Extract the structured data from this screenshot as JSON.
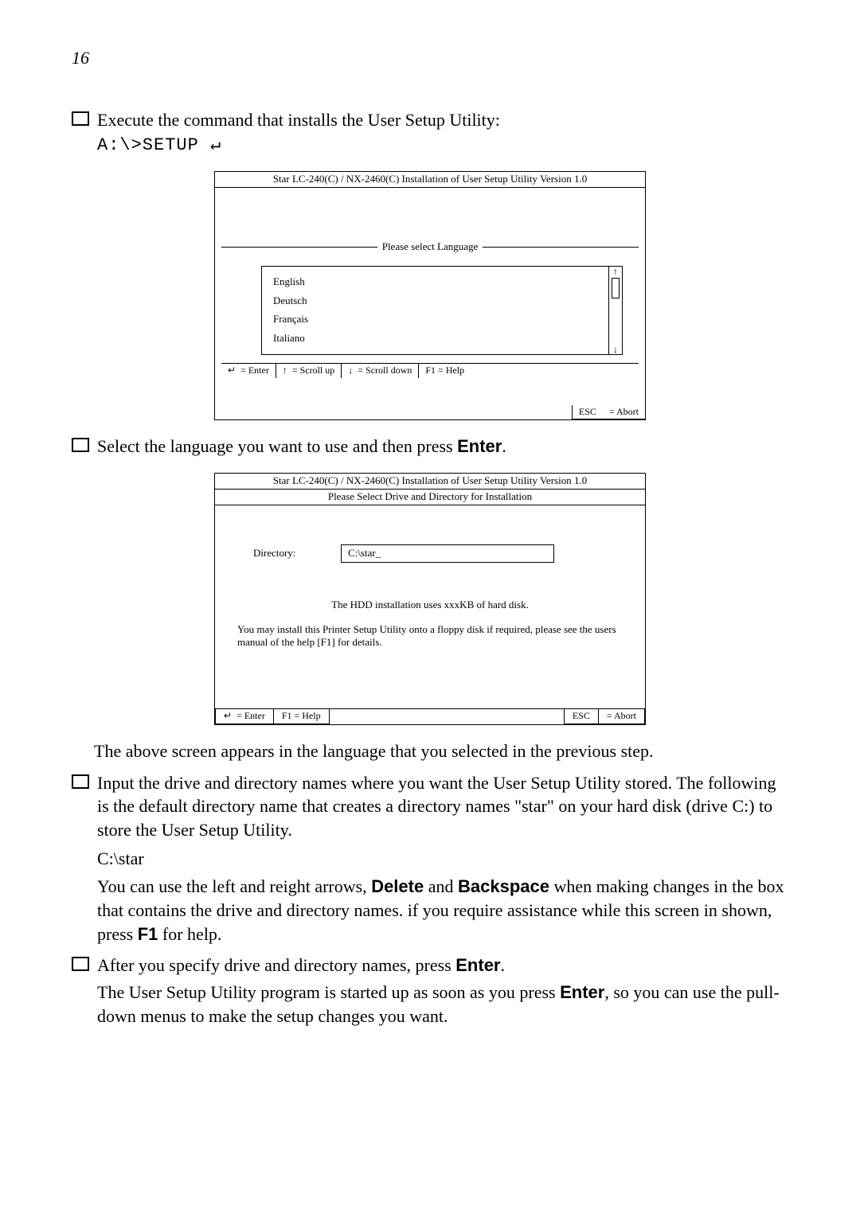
{
  "page_number": "16",
  "bullets": {
    "b1": "Execute the command that installs the User Setup Utility:",
    "b1_cmd": "A:\\>SETUP ↵",
    "b2_pre": "Select the language you want to use and then press ",
    "b2_key": "Enter",
    "b2_post": ".",
    "para_after_dlg2": "The above screen appears in the language that you selected in the previous step.",
    "b3": "Input the drive and directory names where you want the User Setup Utility stored. The following is the default directory name that creates a directory names \"star\" on your hard disk (drive C:) to store the User Setup Utility.",
    "b3_path": "C:\\star",
    "b3_para2_a": "You can use the left and reight arrows, ",
    "b3_key1": "Delete",
    "b3_mid": " and ",
    "b3_key2": "Backspace",
    "b3_para2_b": " when making changes in the box that contains the drive and directory names. if you require assistance while this screen in shown, press ",
    "b3_key3": "F1",
    "b3_para2_c": " for help.",
    "b4_a": "After you specify drive and directory names, press ",
    "b4_key": "Enter",
    "b4_b": ".",
    "b4_para_a": "The User Setup Utility program is started up as soon as you press ",
    "b4_para_key": "Enter",
    "b4_para_b": ", so you can use the pull-down menus to make the setup changes you want."
  },
  "dialog1": {
    "title": "Star LC-240(C) / NX-2460(C) Installation of User Setup Utility Version 1.0",
    "select_label": "Please select Language",
    "languages": [
      "English",
      "Deutsch",
      "Français",
      "Italiano"
    ],
    "help_enter": "= Enter",
    "help_up": "= Scroll up",
    "help_down": "= Scroll down",
    "help_f1": "F1   = Help",
    "abort_esc": "ESC",
    "abort_label": "= Abort"
  },
  "dialog2": {
    "title": "Star LC-240(C) / NX-2460(C) Installation of User Setup Utility Version 1.0",
    "subtitle": "Please Select Drive and Directory for Installation",
    "directory_label": "Directory:",
    "directory_value": "C:\\star_",
    "note1": "The HDD installation uses xxxKB of hard disk.",
    "note2": "You may install this Printer Setup Utility onto a floppy disk if required, please see the users manual of the help [F1] for details.",
    "help_enter": "= Enter",
    "help_f1": "F1   = Help",
    "abort_esc": "ESC",
    "abort_label": "= Abort"
  }
}
